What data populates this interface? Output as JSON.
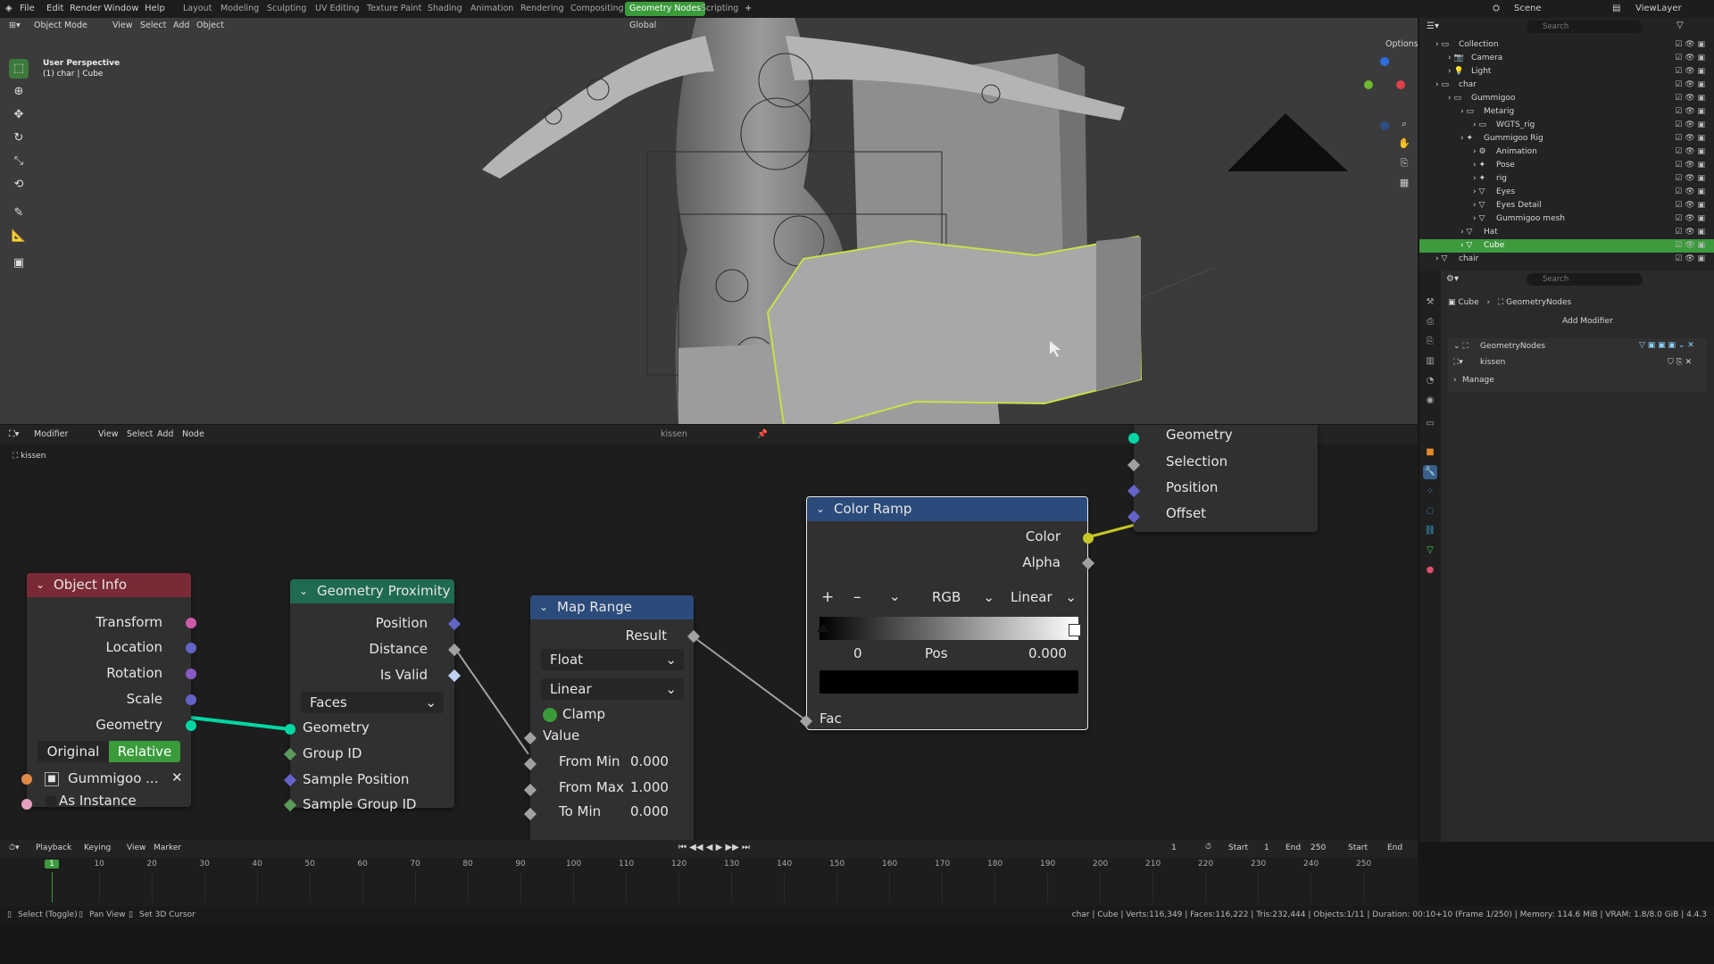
{
  "topbar": {
    "menus": [
      "File",
      "Edit",
      "Render",
      "Window",
      "Help"
    ],
    "workspaces": [
      "Layout",
      "Modeling",
      "Sculpting",
      "UV Editing",
      "Texture Paint",
      "Shading",
      "Animation",
      "Rendering",
      "Compositing",
      "Geometry Nodes",
      "Scripting"
    ],
    "active_workspace": "Geometry Nodes",
    "scene_label": "Scene",
    "viewlayer_label": "ViewLayer"
  },
  "viewport": {
    "mode": "Object Mode",
    "menus": [
      "View",
      "Select",
      "Add",
      "Object"
    ],
    "orientation": "Global",
    "options_label": "Options",
    "overlay_title": "User Perspective",
    "overlay_subtitle": "(1) char | Cube"
  },
  "outliner": {
    "search_placeholder": "Search",
    "rows": [
      {
        "label": "Collection",
        "indent": 0,
        "selected": false
      },
      {
        "label": "Camera",
        "indent": 1,
        "selected": false
      },
      {
        "label": "Light",
        "indent": 1,
        "selected": false
      },
      {
        "label": "char",
        "indent": 0,
        "selected": false
      },
      {
        "label": "Gummigoo",
        "indent": 1,
        "selected": false
      },
      {
        "label": "Metarig",
        "indent": 2,
        "selected": false
      },
      {
        "label": "WGTS_rig",
        "indent": 3,
        "selected": false
      },
      {
        "label": "Gummigoo Rig",
        "indent": 2,
        "selected": false
      },
      {
        "label": "Animation",
        "indent": 3,
        "selected": false
      },
      {
        "label": "Pose",
        "indent": 3,
        "selected": false
      },
      {
        "label": "rig",
        "indent": 3,
        "selected": false
      },
      {
        "label": "Eyes",
        "indent": 3,
        "selected": false
      },
      {
        "label": "Eyes Detail",
        "indent": 3,
        "selected": false
      },
      {
        "label": "Gummigoo mesh",
        "indent": 3,
        "selected": false
      },
      {
        "label": "Hat",
        "indent": 2,
        "selected": false
      },
      {
        "label": "Cube",
        "indent": 2,
        "selected": true
      },
      {
        "label": "chair",
        "indent": 0,
        "selected": false
      }
    ]
  },
  "properties": {
    "search_placeholder": "Search",
    "breadcrumb_object": "Cube",
    "breadcrumb_modifier": "GeometryNodes",
    "add_modifier": "Add Modifier",
    "modifier_name": "GeometryNodes",
    "node_group": "kissen",
    "manage_label": "Manage"
  },
  "node_editor": {
    "editor_type": "Modifier",
    "menus": [
      "View",
      "Select",
      "Add",
      "Node"
    ],
    "group_name": "kissen",
    "breadcrumb": "kissen",
    "nodes": {
      "object_info": {
        "title": "Object Info",
        "outputs": [
          "Transform",
          "Location",
          "Rotation",
          "Scale",
          "Geometry"
        ],
        "toggle_original": "Original",
        "toggle_relative": "Relative",
        "object_value": "Gummigoo ...",
        "as_instance": "As Instance"
      },
      "geometry_proximity": {
        "title": "Geometry Proximity",
        "outputs": [
          "Position",
          "Distance",
          "Is Valid"
        ],
        "mode": "Faces",
        "inputs": [
          "Geometry",
          "Group ID",
          "Sample Position",
          "Sample Group ID"
        ]
      },
      "map_range": {
        "title": "Map Range",
        "output": "Result",
        "data_type": "Float",
        "interpolation": "Linear",
        "clamp_label": "Clamp",
        "value_label": "Value",
        "from_min_label": "From Min",
        "from_min_value": "0.000",
        "from_max_label": "From Max",
        "from_max_value": "1.000",
        "to_min_label": "To Min",
        "to_min_value": "0.000"
      },
      "color_ramp": {
        "title": "Color Ramp",
        "outputs": [
          "Color",
          "Alpha"
        ],
        "color_mode": "RGB",
        "interpolation": "Linear",
        "stop_index": "0",
        "pos_label": "Pos",
        "pos_value": "0.000",
        "fac_label": "Fac"
      },
      "set_position": {
        "inputs": [
          "Geometry",
          "Selection",
          "Position",
          "Offset"
        ]
      }
    }
  },
  "timeline": {
    "menus": [
      "Playback",
      "Keying",
      "View",
      "Marker"
    ],
    "current_frame": "1",
    "start_label": "Start",
    "start_value": "1",
    "end_label": "End",
    "end_value": "250",
    "extra_start": "Start",
    "extra_end": "End",
    "ticks": [
      "1",
      "10",
      "20",
      "30",
      "40",
      "50",
      "60",
      "70",
      "80",
      "90",
      "100",
      "110",
      "120",
      "130",
      "140",
      "150",
      "160",
      "170",
      "180",
      "190",
      "200",
      "210",
      "220",
      "230",
      "240",
      "250"
    ]
  },
  "statusbar": {
    "hint1": "Select (Toggle)",
    "hint2": "Pan View",
    "hint3": "Set 3D Cursor",
    "stats": "char | Cube | Verts:116,349 | Faces:116,222 | Tris:232,444 | Objects:1/11 | Duration: 00:10+10 (Frame 1/250) | Memory: 114.6 MiB | VRAM: 1.8/8.0 GiB | 4.4.3"
  },
  "colors": {
    "accent_green": "#3a9b3a",
    "object_info_header": "#7a2a35",
    "geometry_proximity_header": "#1f6a52",
    "map_range_header": "#2b4b7a",
    "color_ramp_header": "#2b4b7a",
    "geometry_socket": "#00d6a3",
    "vector_socket": "#6363c7",
    "float_socket": "#a1a1a1",
    "matrix_socket": "#cc5aa7",
    "color_socket": "#c7c729",
    "selection_outline": "#c7e04a"
  }
}
